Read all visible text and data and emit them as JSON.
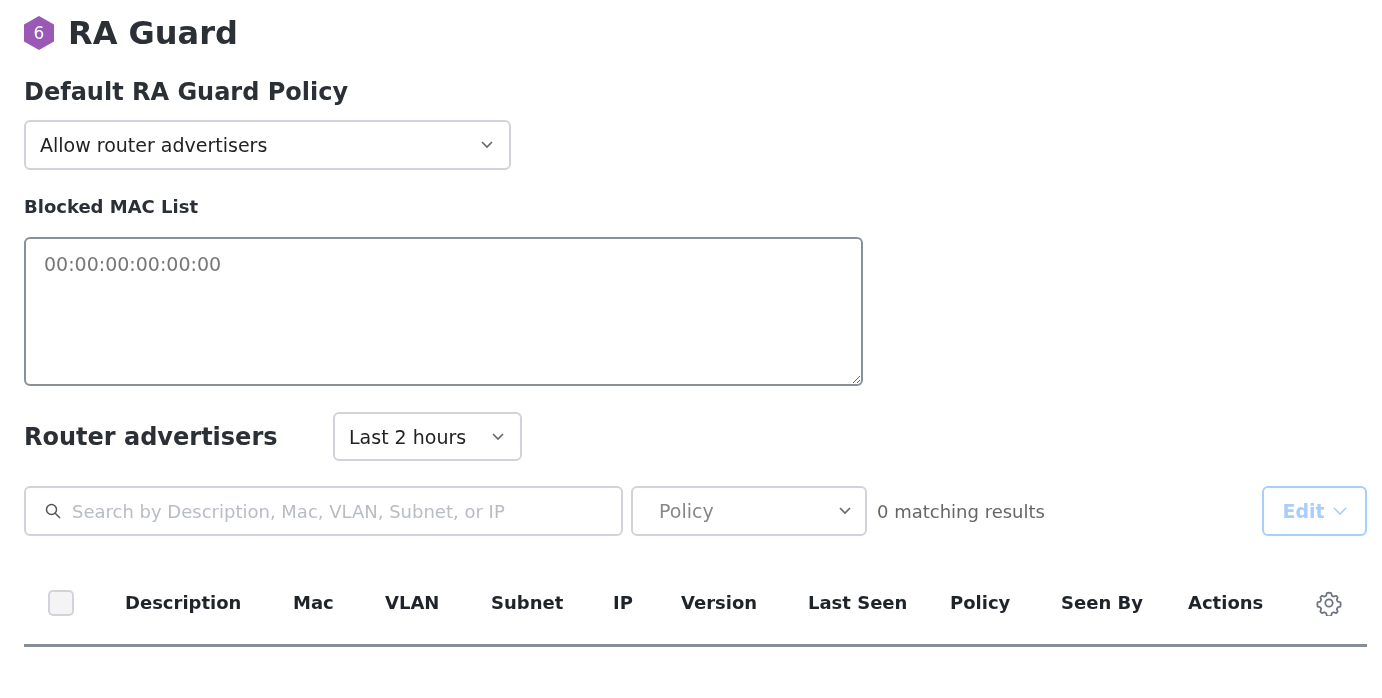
{
  "page": {
    "badge": "6",
    "title": "RA Guard"
  },
  "policy_section": {
    "heading": "Default RA Guard Policy",
    "select_value": "Allow router advertisers"
  },
  "blocked_mac": {
    "label": "Blocked MAC List",
    "placeholder": "00:00:00:00:00:00"
  },
  "router_advertisers": {
    "heading": "Router advertisers",
    "time_range": "Last 2 hours",
    "search": {
      "placeholder": "Search by Description, Mac, VLAN, Subnet, or IP"
    },
    "policy_filter": {
      "placeholder": "Policy"
    },
    "results": "0 matching results",
    "edit_button": {
      "label": "Edit",
      "disabled": true
    },
    "table": {
      "select_all": {
        "checked": false
      },
      "columns": [
        "Description",
        "Mac",
        "VLAN",
        "Subnet",
        "IP",
        "Version",
        "Last Seen",
        "Policy",
        "Seen By",
        "Actions"
      ]
    }
  }
}
